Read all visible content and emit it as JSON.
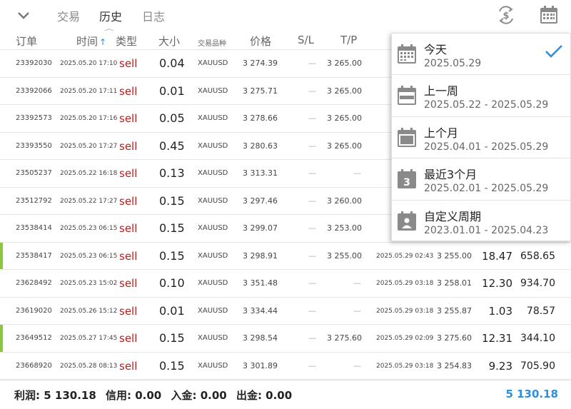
{
  "toolbar": {
    "tabs": [
      {
        "label": "交易",
        "active": false
      },
      {
        "label": "历史",
        "active": true
      },
      {
        "label": "日志",
        "active": false
      }
    ],
    "icons": [
      "chevron-down-icon",
      "currency-exchange-icon",
      "calendar-icon"
    ]
  },
  "table": {
    "headers": {
      "order": "订单",
      "time": "时间",
      "sort_arrow": "↑",
      "type": "类型",
      "size": "大小",
      "symbol": "交易品种",
      "price": "价格",
      "sl": "S/L",
      "tp": "T/P"
    },
    "rows": [
      {
        "order": "23392030",
        "time": "2025.05.20 17:10",
        "type": "sell",
        "size": "0.04",
        "symbol": "XAUUSD",
        "price": "3 274.39",
        "sl": "—",
        "tp": "3 265.00",
        "close_time": "",
        "close_price": "",
        "swap": "",
        "profit": "",
        "marked": false
      },
      {
        "order": "23392066",
        "time": "2025.05.20 17:11",
        "type": "sell",
        "size": "0.01",
        "symbol": "XAUUSD",
        "price": "3 275.71",
        "sl": "—",
        "tp": "3 265.00",
        "close_time": "",
        "close_price": "",
        "swap": "",
        "profit": "",
        "marked": false
      },
      {
        "order": "23392573",
        "time": "2025.05.20 17:16",
        "type": "sell",
        "size": "0.05",
        "symbol": "XAUUSD",
        "price": "3 278.66",
        "sl": "—",
        "tp": "3 265.00",
        "close_time": "",
        "close_price": "",
        "swap": "",
        "profit": "",
        "marked": false
      },
      {
        "order": "23393550",
        "time": "2025.05.20 17:27",
        "type": "sell",
        "size": "0.45",
        "symbol": "XAUUSD",
        "price": "3 280.63",
        "sl": "—",
        "tp": "3 265.00",
        "close_time": "",
        "close_price": "",
        "swap": "",
        "profit": "",
        "marked": false
      },
      {
        "order": "23505237",
        "time": "2025.05.22 16:18",
        "type": "sell",
        "size": "0.13",
        "symbol": "XAUUSD",
        "price": "3 313.31",
        "sl": "—",
        "tp": "—",
        "close_time": "",
        "close_price": "",
        "swap": "",
        "profit": "",
        "marked": false
      },
      {
        "order": "23512792",
        "time": "2025.05.22 17:27",
        "type": "sell",
        "size": "0.15",
        "symbol": "XAUUSD",
        "price": "3 297.46",
        "sl": "—",
        "tp": "3 260.00",
        "close_time": "",
        "close_price": "",
        "swap": "",
        "profit": "",
        "marked": false
      },
      {
        "order": "23538414",
        "time": "2025.05.23 06:15",
        "type": "sell",
        "size": "0.15",
        "symbol": "XAUUSD",
        "price": "3 299.07",
        "sl": "—",
        "tp": "3 253.00",
        "close_time": "",
        "close_price": "",
        "swap": "",
        "profit": "",
        "marked": false
      },
      {
        "order": "23538417",
        "time": "2025.05.23 06:15",
        "type": "sell",
        "size": "0.15",
        "symbol": "XAUUSD",
        "price": "3 298.91",
        "sl": "—",
        "tp": "3 255.00",
        "close_time": "2025.05.29 02:43",
        "close_price": "3 255.00",
        "swap": "18.47",
        "profit": "658.65",
        "marked": true
      },
      {
        "order": "23628492",
        "time": "2025.05.23 15:02",
        "type": "sell",
        "size": "0.10",
        "symbol": "XAUUSD",
        "price": "3 351.48",
        "sl": "—",
        "tp": "—",
        "close_time": "2025.05.29 03:18",
        "close_price": "3 258.01",
        "swap": "12.30",
        "profit": "934.70",
        "marked": false
      },
      {
        "order": "23619020",
        "time": "2025.05.26 15:12",
        "type": "sell",
        "size": "0.01",
        "symbol": "XAUUSD",
        "price": "3 334.44",
        "sl": "—",
        "tp": "—",
        "close_time": "2025.05.29 03:18",
        "close_price": "3 255.87",
        "swap": "1.03",
        "profit": "78.57",
        "marked": false
      },
      {
        "order": "23649512",
        "time": "2025.05.27 17:45",
        "type": "sell",
        "size": "0.15",
        "symbol": "XAUUSD",
        "price": "3 298.54",
        "sl": "—",
        "tp": "3 275.60",
        "close_time": "2025.05.29 02:09",
        "close_price": "3 275.60",
        "swap": "12.31",
        "profit": "344.10",
        "marked": true
      },
      {
        "order": "23668920",
        "time": "2025.05.28 08:13",
        "type": "sell",
        "size": "0.15",
        "symbol": "XAUUSD",
        "price": "3 301.89",
        "sl": "—",
        "tp": "—",
        "close_time": "2025.05.29 03:18",
        "close_price": "3 254.83",
        "swap": "9.23",
        "profit": "705.90",
        "marked": false
      }
    ]
  },
  "footer": {
    "profit": "利润: 5 130.18",
    "credit": "信用: 0.00",
    "deposit": "入金: 0.00",
    "withdrawal": "出金: 0.00",
    "total": "5 130.18"
  },
  "period_menu": {
    "items": [
      {
        "title": "今天",
        "range": "2025.05.29",
        "selected": true,
        "icon": "calendar-today-icon"
      },
      {
        "title": "上一周",
        "range": "2025.05.22 - 2025.05.29",
        "selected": false,
        "icon": "calendar-week-icon"
      },
      {
        "title": "上个月",
        "range": "2025.04.01 - 2025.05.29",
        "selected": false,
        "icon": "calendar-month-icon"
      },
      {
        "title": "最近3个月",
        "range": "2025.02.01 - 2025.05.29",
        "selected": false,
        "icon": "calendar-3-icon",
        "icon_text": "3"
      },
      {
        "title": "自定义周期",
        "range": "2023.01.01 - 2025.04.23",
        "selected": false,
        "icon": "calendar-custom-icon"
      }
    ]
  },
  "colors": {
    "accent": "#2f8fd8",
    "sell": "#b22222",
    "marker": "#8cc63f",
    "icon_gray": "#8a8a8a"
  }
}
